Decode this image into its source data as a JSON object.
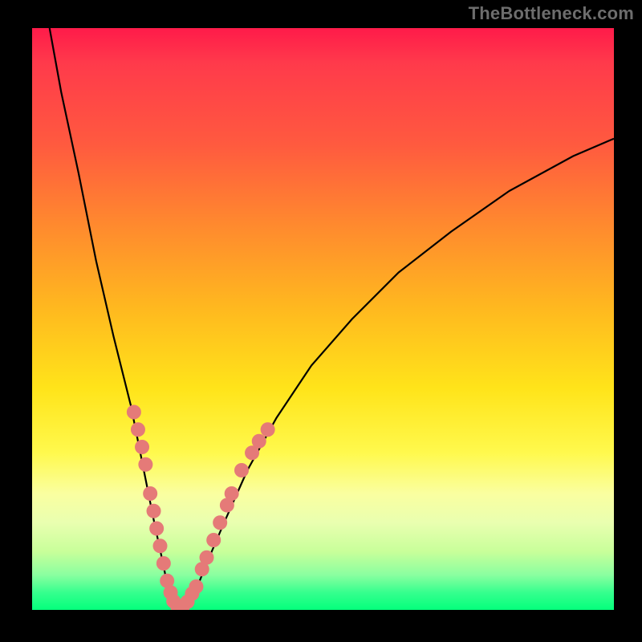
{
  "watermark": "TheBottleneck.com",
  "colors": {
    "frame": "#000000",
    "curve": "#000000",
    "markers": "#e57a78",
    "gradient_top": "#ff1b4a",
    "gradient_bottom": "#04ff7c"
  },
  "chart_data": {
    "type": "line",
    "title": "",
    "xlabel": "",
    "ylabel": "",
    "xlim": [
      0,
      100
    ],
    "ylim": [
      0,
      100
    ],
    "grid": false,
    "note": "V-shaped bottleneck curve; y = 0 indicates balanced configuration (green band). Values estimated from pixel positions; no numeric axes present.",
    "series": [
      {
        "name": "bottleneck-curve",
        "x": [
          3,
          5,
          8,
          11,
          14,
          17,
          19,
          21,
          22.5,
          23.5,
          24.5,
          26,
          28,
          30,
          33,
          37,
          42,
          48,
          55,
          63,
          72,
          82,
          93,
          100
        ],
        "y": [
          100,
          89,
          75,
          60,
          47,
          35,
          25,
          15,
          8,
          3,
          0.5,
          0.5,
          3,
          8,
          15,
          24,
          33,
          42,
          50,
          58,
          65,
          72,
          78,
          81
        ]
      }
    ],
    "markers": {
      "name": "highlighted-points",
      "note": "Salmon dots clustered near curve minimum on both branches.",
      "points": [
        {
          "x": 17.5,
          "y": 34
        },
        {
          "x": 18.2,
          "y": 31
        },
        {
          "x": 18.9,
          "y": 28
        },
        {
          "x": 19.5,
          "y": 25
        },
        {
          "x": 20.3,
          "y": 20
        },
        {
          "x": 20.9,
          "y": 17
        },
        {
          "x": 21.4,
          "y": 14
        },
        {
          "x": 22.0,
          "y": 11
        },
        {
          "x": 22.6,
          "y": 8
        },
        {
          "x": 23.2,
          "y": 5
        },
        {
          "x": 23.8,
          "y": 3
        },
        {
          "x": 24.3,
          "y": 1.5
        },
        {
          "x": 25.0,
          "y": 0.6
        },
        {
          "x": 25.9,
          "y": 0.6
        },
        {
          "x": 26.7,
          "y": 1.4
        },
        {
          "x": 27.5,
          "y": 2.8
        },
        {
          "x": 28.2,
          "y": 4
        },
        {
          "x": 29.2,
          "y": 7
        },
        {
          "x": 30.0,
          "y": 9
        },
        {
          "x": 31.2,
          "y": 12
        },
        {
          "x": 32.3,
          "y": 15
        },
        {
          "x": 33.5,
          "y": 18
        },
        {
          "x": 34.3,
          "y": 20
        },
        {
          "x": 36.0,
          "y": 24
        },
        {
          "x": 37.8,
          "y": 27
        },
        {
          "x": 39.0,
          "y": 29
        },
        {
          "x": 40.5,
          "y": 31
        }
      ]
    }
  }
}
